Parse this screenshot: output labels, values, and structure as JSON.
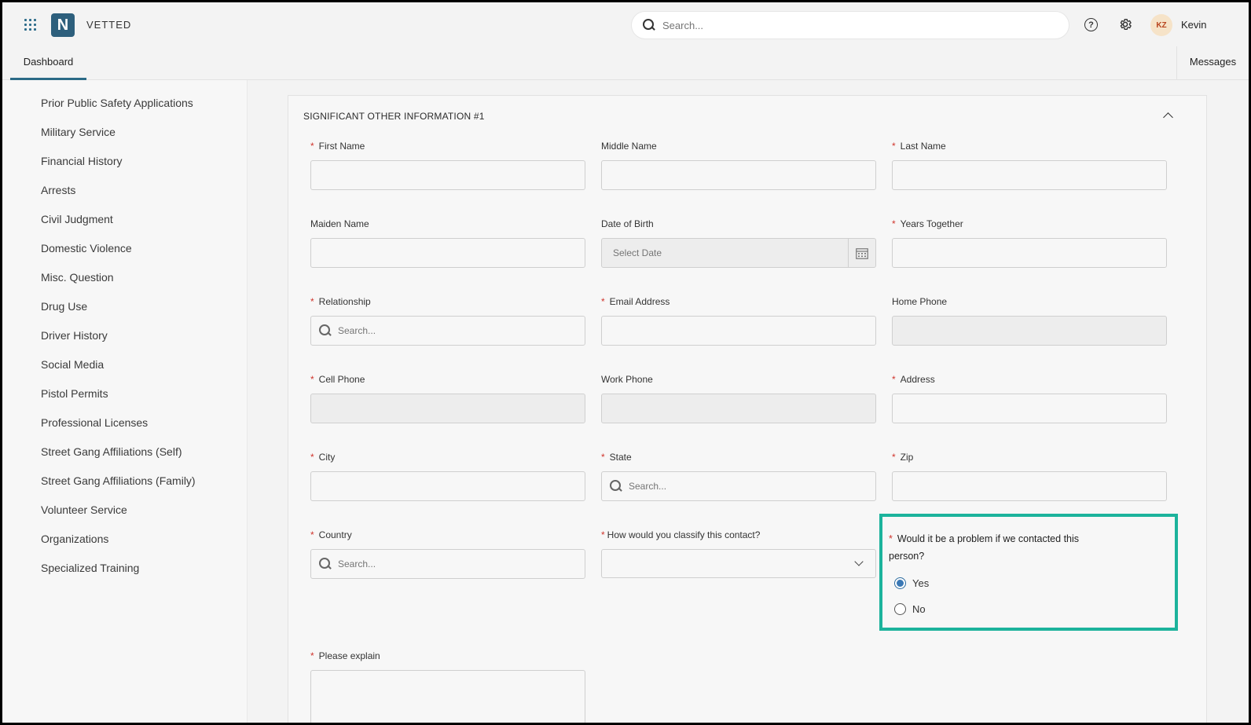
{
  "header": {
    "brand": "VETTED",
    "logo_letter": "N",
    "search_placeholder": "Search...",
    "user_initials": "KZ",
    "user_name": "Kevin",
    "help_glyph": "?"
  },
  "tabs": {
    "dashboard": "Dashboard",
    "messages": "Messages"
  },
  "sidebar": {
    "items": [
      "Prior Public Safety Applications",
      "Military Service",
      "Financial History",
      "Arrests",
      "Civil Judgment",
      "Domestic Violence",
      "Misc. Question",
      "Drug Use",
      "Driver History",
      "Social Media",
      "Pistol Permits",
      "Professional Licenses",
      "Street Gang Affiliations (Self)",
      "Street Gang Affiliations (Family)",
      "Volunteer Service",
      "Organizations",
      "Specialized Training"
    ]
  },
  "form": {
    "section_title": "SIGNIFICANT OTHER INFORMATION #1",
    "required_mark": "*",
    "labels": {
      "first_name": "First Name",
      "middle_name": "Middle Name",
      "last_name": "Last Name",
      "maiden_name": "Maiden Name",
      "dob": "Date of Birth",
      "years_together": "Years Together",
      "relationship": "Relationship",
      "email": "Email Address",
      "home_phone": "Home Phone",
      "cell_phone": "Cell Phone",
      "work_phone": "Work Phone",
      "address": "Address",
      "city": "City",
      "state": "State",
      "zip": "Zip",
      "country": "Country",
      "classify": "How would you classify this contact?",
      "problem_q": "Would it be a problem if we contacted this person?",
      "explain": "Please explain"
    },
    "placeholders": {
      "search": "Search...",
      "date": "Select Date"
    },
    "radio": {
      "yes": "Yes",
      "no": "No",
      "selected": "Yes"
    }
  },
  "colors": {
    "accent": "#2b6a86",
    "highlight": "#1cb39c",
    "required": "#d0342c"
  }
}
